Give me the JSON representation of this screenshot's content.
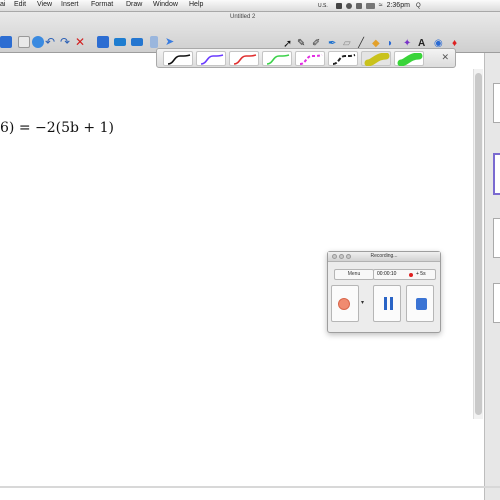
{
  "menubar": {
    "items": [
      "ai",
      "Edit",
      "View",
      "Insert",
      "Format",
      "Draw",
      "Window",
      "Help"
    ],
    "status_text": [
      "U.S.",
      "2:36pm",
      "≈",
      "Q"
    ]
  },
  "window": {
    "title": "Untitled 2"
  },
  "pen_colors": [
    "#111111",
    "#6a3bff",
    "#e03030",
    "#3cd24a",
    "#e22ee2",
    "#222222"
  ],
  "highlighter_colors": [
    "#c9c21d",
    "#3ad43a"
  ],
  "canvas": {
    "equation": "6) = −2(5b + 1)"
  },
  "recording": {
    "title": "Recording...",
    "menu_label": "Menu",
    "time": "00:00:10",
    "seconds": "+ 5s"
  }
}
